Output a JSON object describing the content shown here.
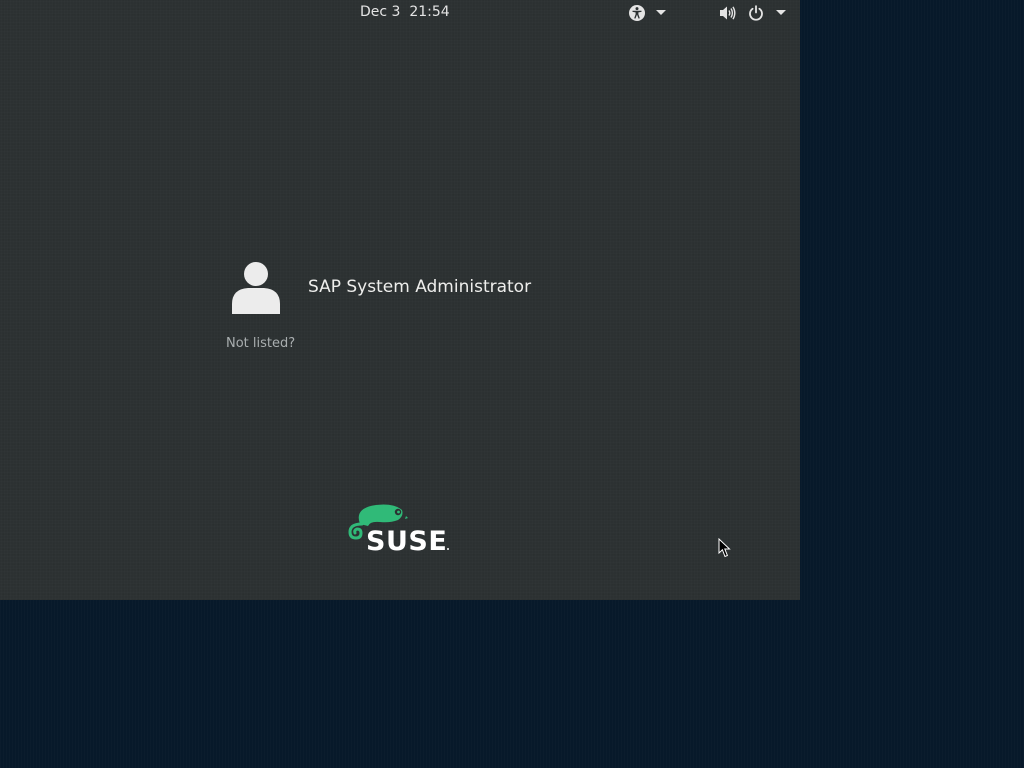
{
  "top_bar": {
    "date": "Dec 3",
    "time": "21:54",
    "accessibility_icon": "accessibility-icon",
    "volume_icon": "volume-icon",
    "power_icon": "power-icon"
  },
  "users": [
    {
      "name": "SAP System Administrator",
      "avatar_icon": "user-silhouette-icon"
    }
  ],
  "not_listed_label": "Not listed?",
  "branding": {
    "logo_text": "SUSE",
    "logo_color": "#30ba78"
  },
  "colors": {
    "panel_bg": "#2c3132",
    "outer_bg": "#07192a",
    "text": "#eeeeec",
    "muted_text": "#a9aeaf"
  }
}
